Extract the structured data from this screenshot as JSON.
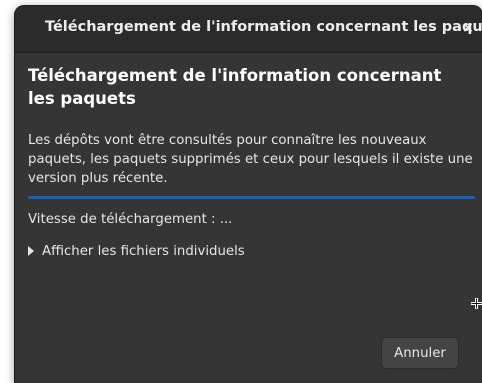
{
  "window": {
    "title": "Téléchargement de l'information concernant les paquets",
    "close_glyph": "×"
  },
  "dialog": {
    "heading": "Téléchargement de l'information concernant les paquets",
    "description": "Les dépôts vont être consultés pour connaître les nouveaux paquets, les paquets supprimés et ceux pour lesquels il existe une version plus récente.",
    "progress_fraction": 1.0,
    "speed_label": "Vitesse de téléchargement : ...",
    "expander_label": "Afficher les fichiers individuels",
    "cancel_label": "Annuler"
  },
  "icons": {
    "close": "close-icon",
    "expander": "triangle-right-icon",
    "cursor": "crosshair-cursor-icon"
  },
  "colors": {
    "window_bg": "#353535",
    "titlebar_bg": "#2b2b2b",
    "progress_fill": "#2a5f9e",
    "text": "#e6e6e6"
  }
}
